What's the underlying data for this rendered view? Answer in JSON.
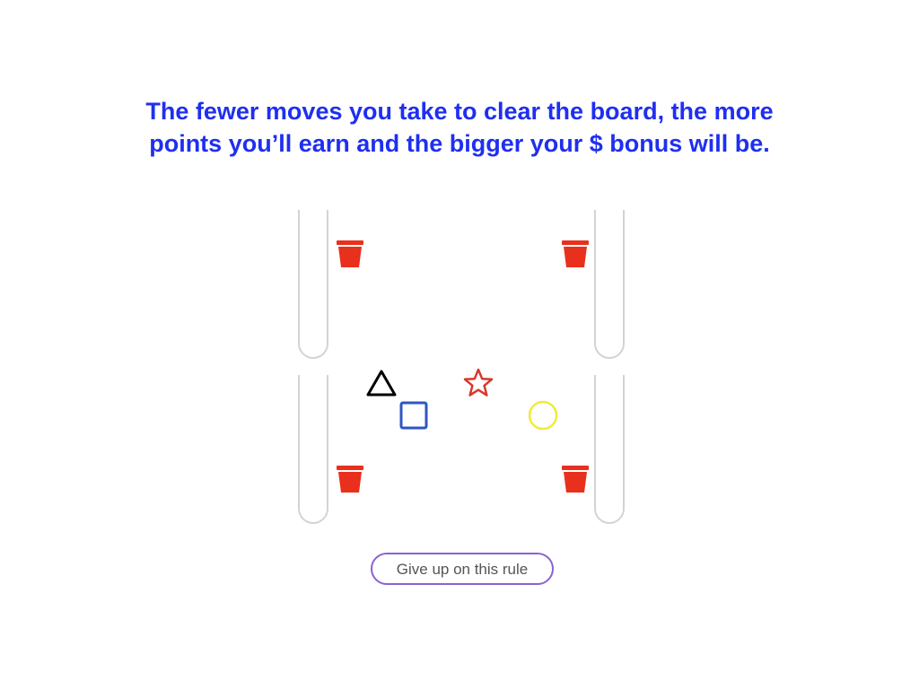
{
  "instruction": {
    "line1": "The fewer moves you take to clear the board, the more",
    "line2": "points you’ll earn and the bigger your $ bonus will be.",
    "color": "#1f2ff0"
  },
  "board": {
    "buckets": [
      {
        "corner": "top-left",
        "icon": "bucket-icon",
        "color": "#e8301d"
      },
      {
        "corner": "top-right",
        "icon": "bucket-icon",
        "color": "#e8301d"
      },
      {
        "corner": "bottom-left",
        "icon": "bucket-icon",
        "color": "#e8301d"
      },
      {
        "corner": "bottom-right",
        "icon": "bucket-icon",
        "color": "#e8301d"
      }
    ],
    "pieces": [
      {
        "shape": "triangle",
        "color": "#000000"
      },
      {
        "shape": "star",
        "color": "#d9382a"
      },
      {
        "shape": "square",
        "color": "#2f55c4"
      },
      {
        "shape": "circle",
        "color": "#f2ea3a"
      }
    ]
  },
  "give_up_button": {
    "label": "Give up on this rule",
    "border_color": "#8a63d2"
  }
}
